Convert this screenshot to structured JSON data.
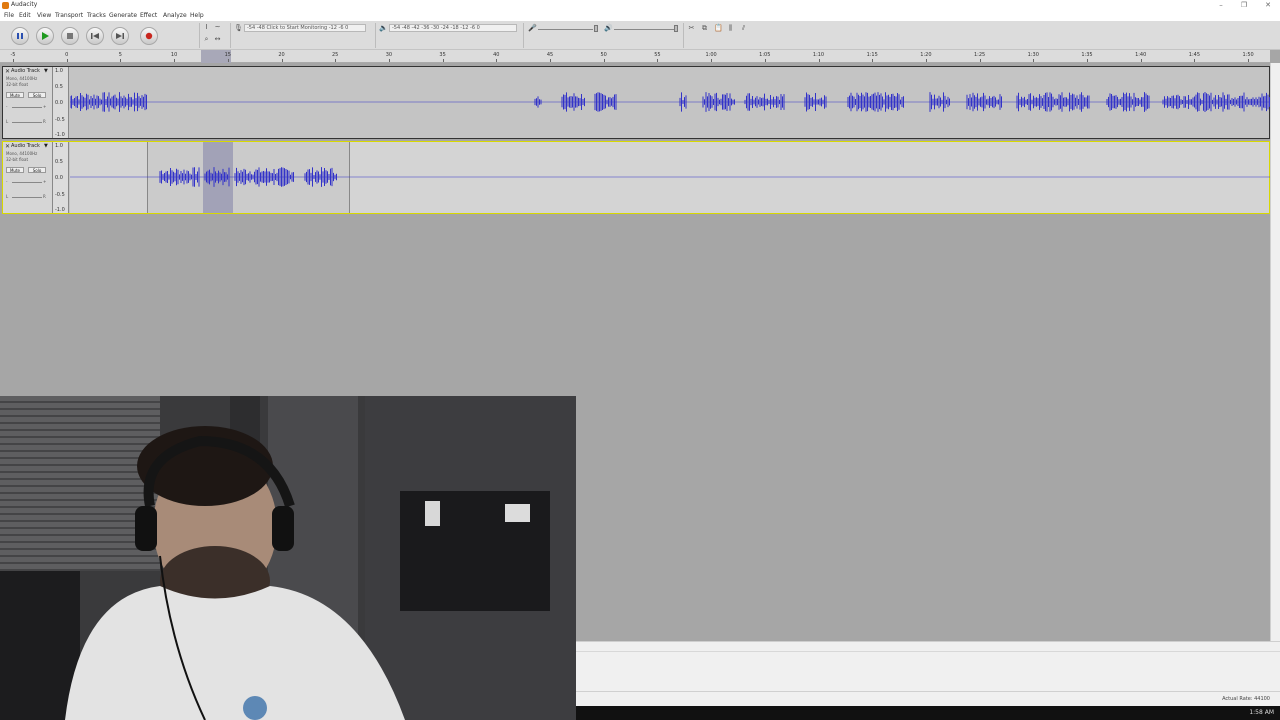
{
  "window": {
    "title": "Audacity",
    "minimize": "–",
    "maximize": "❐",
    "close": "✕"
  },
  "menu": [
    "File",
    "Edit",
    "View",
    "Transport",
    "Tracks",
    "Generate",
    "Effect",
    "Analyze",
    "Help"
  ],
  "meters": {
    "record_ticks": "-54  -48  Click to Start Monitoring  -12   -6   0",
    "playback_ticks": "-54  -48  -42  -36  -30  -24  -18  -12   -6   0",
    "record_channels": "L\nR",
    "playback_channels": "L\nR"
  },
  "ruler": {
    "ticks": [
      "-5",
      "0",
      "5",
      "10",
      "15",
      "20",
      "25",
      "30",
      "35",
      "40",
      "45",
      "50",
      "55",
      "1:00",
      "1:05",
      "1:10",
      "1:15",
      "1:20",
      "1:25",
      "1:30",
      "1:35",
      "1:40",
      "1:45",
      "1:50"
    ]
  },
  "tracks": [
    {
      "name": "Audio Track",
      "close": "✕",
      "menu_arrow": "▼",
      "info_line1": "Mono, 44100Hz",
      "info_line2": "32-bit float",
      "mute": "Mute",
      "solo": "Solo",
      "gain_minus": "-",
      "gain_plus": "+",
      "pan_left": "L",
      "pan_right": "R",
      "scale": [
        "1.0",
        "0.5",
        "0.0",
        "-0.5",
        "-1.0"
      ]
    },
    {
      "name": "Audio Track",
      "close": "✕",
      "menu_arrow": "▼",
      "info_line1": "Mono, 44100Hz",
      "info_line2": "32-bit float",
      "mute": "Mute",
      "solo": "Solo",
      "gain_minus": "-",
      "gain_plus": "+",
      "pan_left": "L",
      "pan_right": "R",
      "scale": [
        "1.0",
        "0.5",
        "0.0",
        "-0.5",
        "-1.0"
      ],
      "selected": true
    }
  ],
  "status": {
    "actual_rate": "Actual Rate: 44100"
  },
  "taskbar": {
    "clock": "1:58 AM"
  },
  "icons": {
    "pause": "pause-icon",
    "play": "play-icon",
    "stop": "stop-icon",
    "skip_start": "skip-start-icon",
    "skip_end": "skip-end-icon",
    "record": "record-icon"
  },
  "colors": {
    "waveform": "#3232c8",
    "selection": "#9b9bb4",
    "record": "#c8261e",
    "play": "#1e9a1e"
  }
}
